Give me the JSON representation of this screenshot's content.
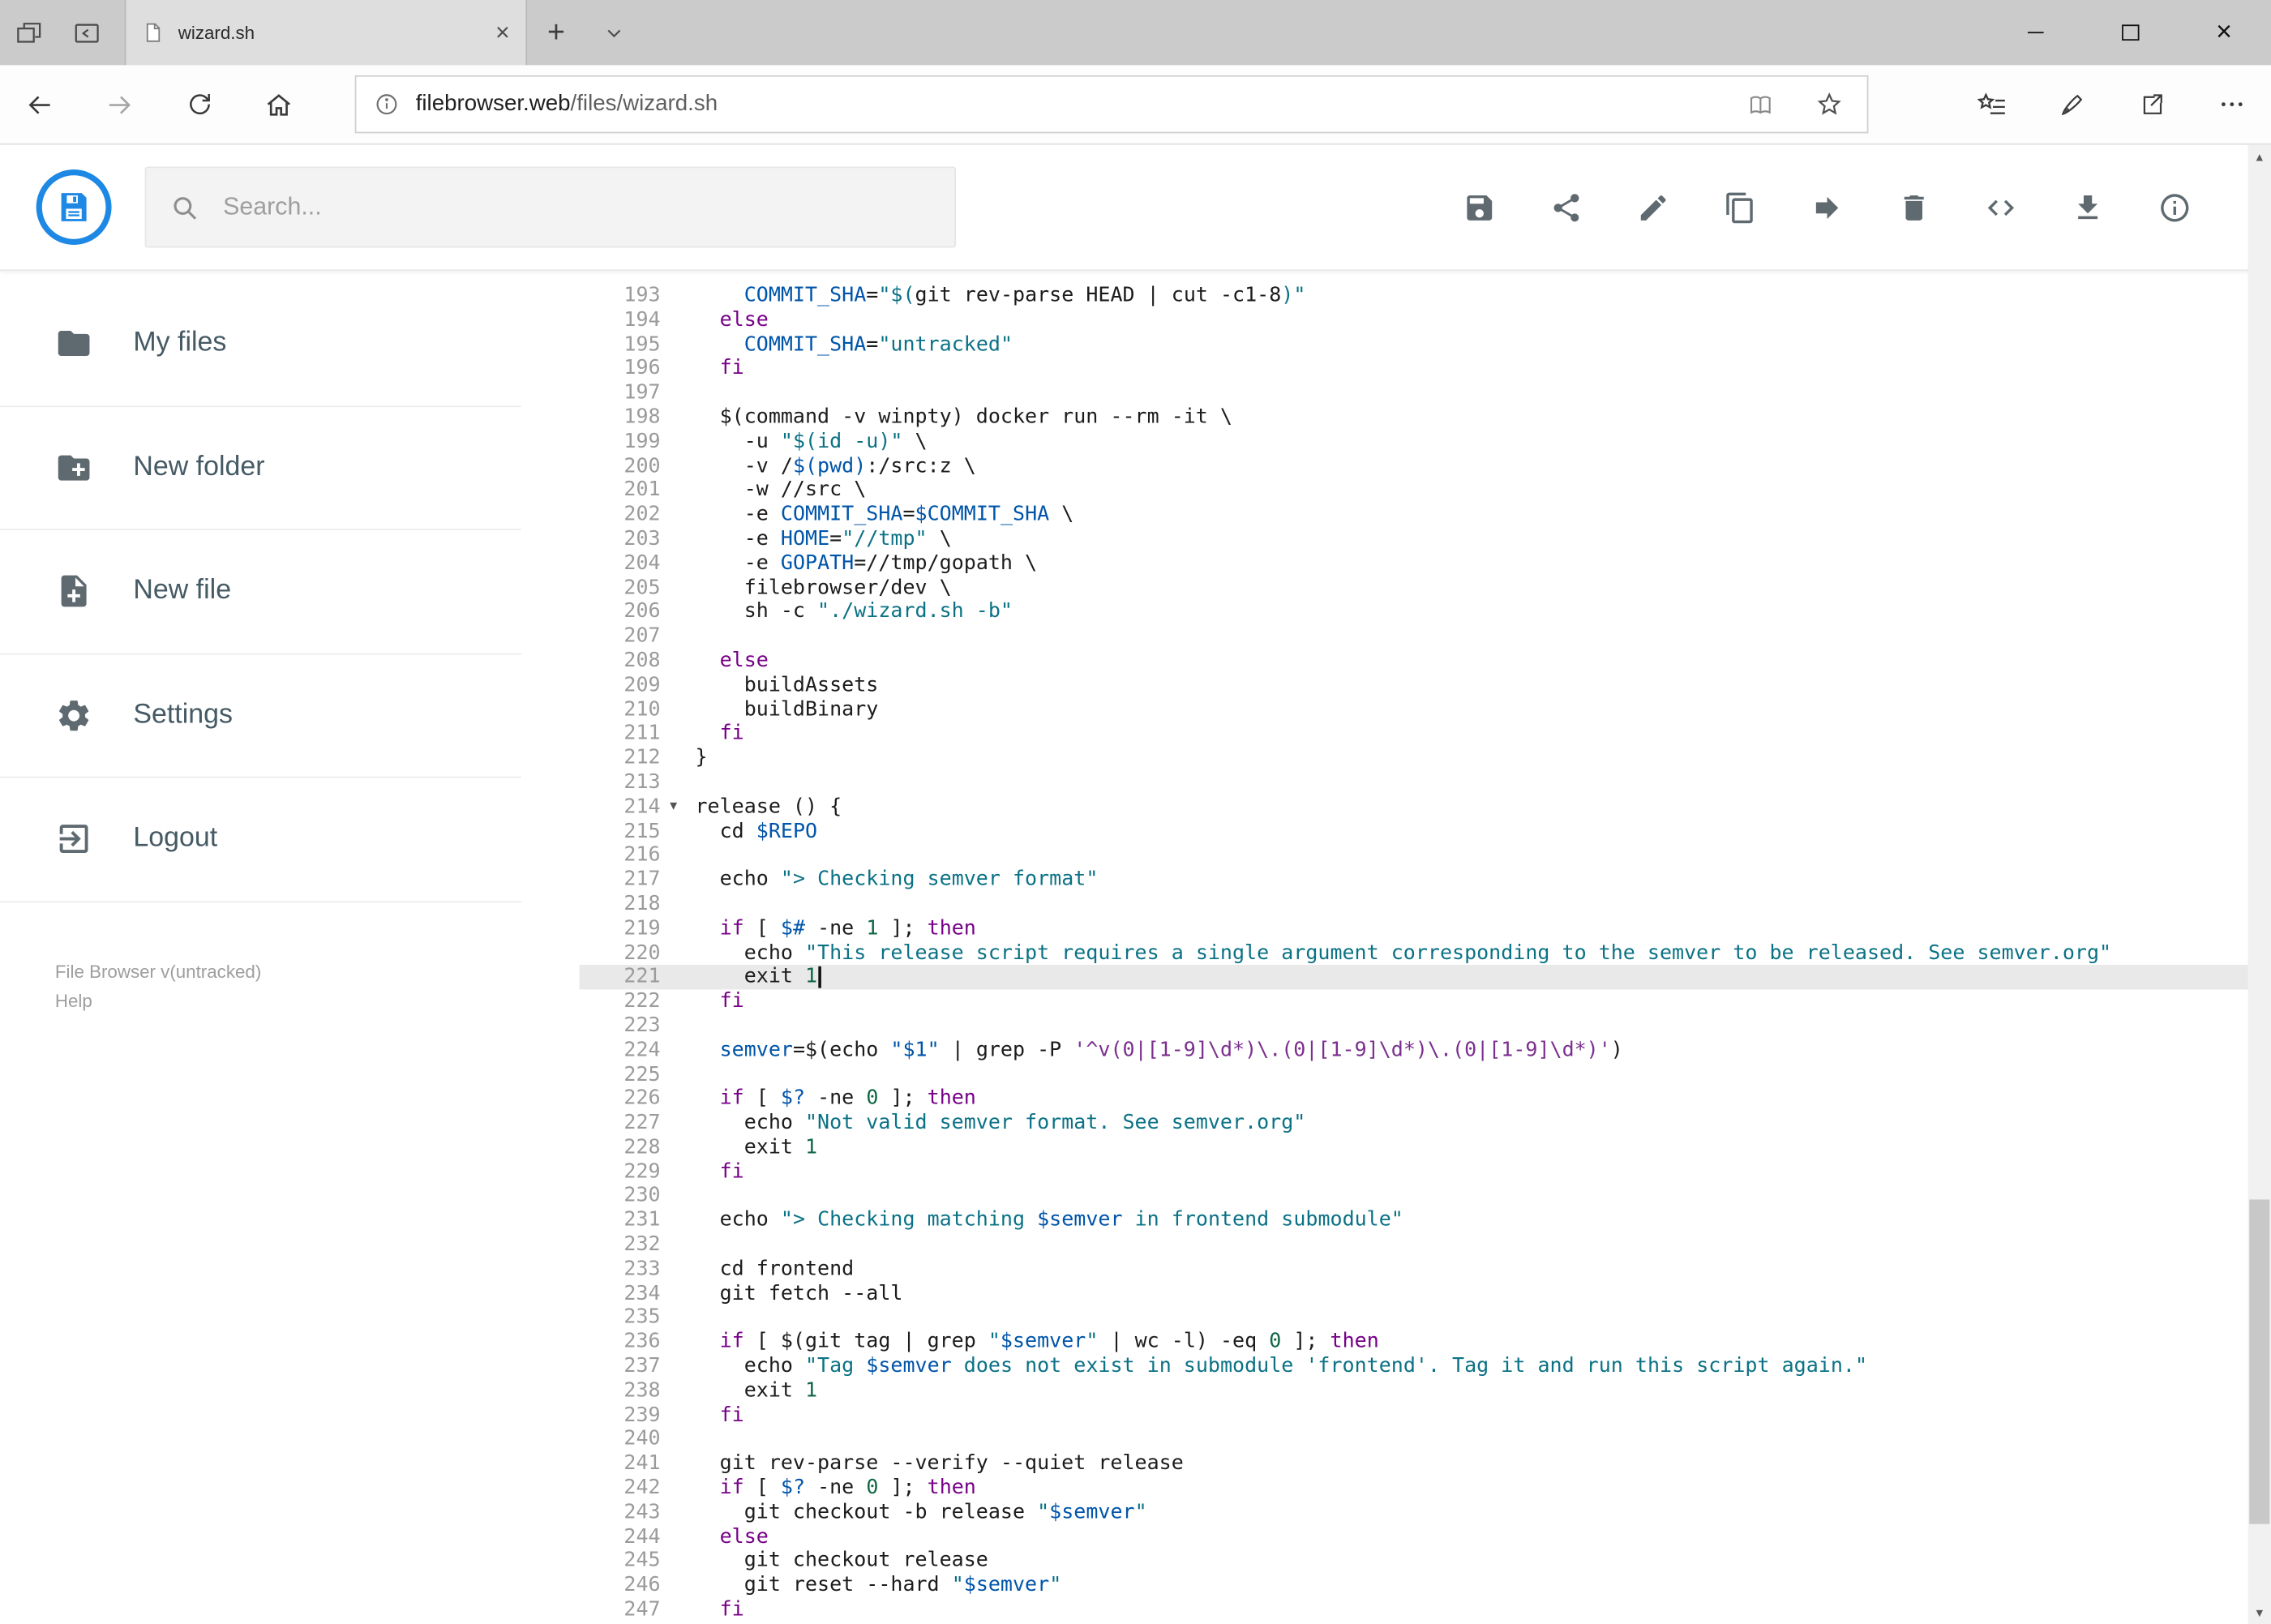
{
  "browser": {
    "tab_title": "wizard.sh",
    "strip_icons": [
      "tab-preview",
      "set-tabs-aside",
      "new-tab",
      "tab-list-chevron"
    ],
    "window_controls": [
      "minimize",
      "maximize",
      "close"
    ],
    "nav_icons": [
      "back",
      "forward",
      "refresh",
      "home"
    ],
    "addressbar": {
      "url_domain": "filebrowser.web",
      "url_path": "/files/wizard.sh",
      "icons": [
        "info",
        "reading-view",
        "favorite-star"
      ]
    },
    "nav_right_icons": [
      "hub",
      "web-note-pen",
      "share",
      "more"
    ]
  },
  "app": {
    "search": {
      "placeholder": "Search..."
    },
    "toolbar_icons": [
      "save",
      "share",
      "edit",
      "copy",
      "move",
      "delete",
      "code",
      "download",
      "info"
    ],
    "sidebar": {
      "items": [
        {
          "label": "My files",
          "icon": "folder"
        },
        {
          "label": "New folder",
          "icon": "create-new-folder"
        },
        {
          "label": "New file",
          "icon": "new-file"
        },
        {
          "label": "Settings",
          "icon": "settings"
        },
        {
          "label": "Logout",
          "icon": "logout"
        }
      ],
      "footer_version": "File Browser v(untracked)",
      "footer_help": "Help"
    },
    "editor": {
      "first_visible_line": 193,
      "last_visible_line": 247,
      "active_line": 221,
      "fold_marker_line": 214,
      "lines": [
        {
          "n": 193,
          "t": [
            [
              "p",
              "    "
            ],
            [
              "v",
              "COMMIT_SHA"
            ],
            [
              "p",
              "="
            ],
            [
              "s",
              "\"$("
            ],
            [
              "p",
              "git rev-parse HEAD | cut -c1-8"
            ],
            [
              "s",
              ")\""
            ]
          ]
        },
        {
          "n": 194,
          "t": [
            [
              "p",
              "  "
            ],
            [
              "k",
              "else"
            ]
          ]
        },
        {
          "n": 195,
          "t": [
            [
              "p",
              "    "
            ],
            [
              "v",
              "COMMIT_SHA"
            ],
            [
              "p",
              "="
            ],
            [
              "s",
              "\"untracked\""
            ]
          ]
        },
        {
          "n": 196,
          "t": [
            [
              "p",
              "  "
            ],
            [
              "k",
              "fi"
            ]
          ]
        },
        {
          "n": 197,
          "t": []
        },
        {
          "n": 198,
          "t": [
            [
              "p",
              "  $(command -v winpty) docker run --rm -it \\"
            ]
          ]
        },
        {
          "n": 199,
          "t": [
            [
              "p",
              "    -u "
            ],
            [
              "s",
              "\"$(id -u)\""
            ],
            [
              "p",
              " \\"
            ]
          ]
        },
        {
          "n": 200,
          "t": [
            [
              "p",
              "    -v /"
            ],
            [
              "v",
              "$(pwd)"
            ],
            [
              "p",
              ":/src:z \\"
            ]
          ]
        },
        {
          "n": 201,
          "t": [
            [
              "p",
              "    -w //src \\"
            ]
          ]
        },
        {
          "n": 202,
          "t": [
            [
              "p",
              "    -e "
            ],
            [
              "v",
              "COMMIT_SHA"
            ],
            [
              "p",
              "="
            ],
            [
              "v",
              "$COMMIT_SHA"
            ],
            [
              "p",
              " \\"
            ]
          ]
        },
        {
          "n": 203,
          "t": [
            [
              "p",
              "    -e "
            ],
            [
              "v",
              "HOME"
            ],
            [
              "p",
              "="
            ],
            [
              "s",
              "\"//tmp\""
            ],
            [
              "p",
              " \\"
            ]
          ]
        },
        {
          "n": 204,
          "t": [
            [
              "p",
              "    -e "
            ],
            [
              "v",
              "GOPATH"
            ],
            [
              "p",
              "=//tmp/gopath \\"
            ]
          ]
        },
        {
          "n": 205,
          "t": [
            [
              "p",
              "    filebrowser/dev \\"
            ]
          ]
        },
        {
          "n": 206,
          "t": [
            [
              "p",
              "    sh -c "
            ],
            [
              "s",
              "\"./wizard.sh -b\""
            ]
          ]
        },
        {
          "n": 207,
          "t": []
        },
        {
          "n": 208,
          "t": [
            [
              "p",
              "  "
            ],
            [
              "k",
              "else"
            ]
          ]
        },
        {
          "n": 209,
          "t": [
            [
              "p",
              "    buildAssets"
            ]
          ]
        },
        {
          "n": 210,
          "t": [
            [
              "p",
              "    buildBinary"
            ]
          ]
        },
        {
          "n": 211,
          "t": [
            [
              "p",
              "  "
            ],
            [
              "k",
              "fi"
            ]
          ]
        },
        {
          "n": 212,
          "t": [
            [
              "p",
              "}"
            ]
          ]
        },
        {
          "n": 213,
          "t": []
        },
        {
          "n": 214,
          "t": [
            [
              "p",
              "release () {"
            ]
          ]
        },
        {
          "n": 215,
          "t": [
            [
              "p",
              "  cd "
            ],
            [
              "v",
              "$REPO"
            ]
          ]
        },
        {
          "n": 216,
          "t": []
        },
        {
          "n": 217,
          "t": [
            [
              "p",
              "  echo "
            ],
            [
              "s",
              "\"> Checking semver format\""
            ]
          ]
        },
        {
          "n": 218,
          "t": []
        },
        {
          "n": 219,
          "t": [
            [
              "p",
              "  "
            ],
            [
              "k",
              "if"
            ],
            [
              "p",
              " [ "
            ],
            [
              "v",
              "$#"
            ],
            [
              "p",
              " -ne "
            ],
            [
              "n",
              "1"
            ],
            [
              "p",
              " ]; "
            ],
            [
              "k",
              "then"
            ]
          ]
        },
        {
          "n": 220,
          "t": [
            [
              "p",
              "    echo "
            ],
            [
              "s",
              "\"This release script requires a single argument corresponding to the semver to be released. See semver.org\""
            ]
          ]
        },
        {
          "n": 221,
          "t": [
            [
              "p",
              "    exit "
            ],
            [
              "n",
              "1"
            ]
          ]
        },
        {
          "n": 222,
          "t": [
            [
              "p",
              "  "
            ],
            [
              "k",
              "fi"
            ]
          ]
        },
        {
          "n": 223,
          "t": []
        },
        {
          "n": 224,
          "t": [
            [
              "p",
              "  "
            ],
            [
              "v",
              "semver"
            ],
            [
              "p",
              "=$(echo "
            ],
            [
              "v",
              "\"$1\""
            ],
            [
              "p",
              " | grep -P "
            ],
            [
              "r",
              "'^v(0|[1-9]\\d*)\\.(0|[1-9]\\d*)\\.(0|[1-9]\\d*)'"
            ],
            [
              "p",
              ")"
            ]
          ]
        },
        {
          "n": 225,
          "t": []
        },
        {
          "n": 226,
          "t": [
            [
              "p",
              "  "
            ],
            [
              "k",
              "if"
            ],
            [
              "p",
              " [ "
            ],
            [
              "v",
              "$?"
            ],
            [
              "p",
              " -ne "
            ],
            [
              "n",
              "0"
            ],
            [
              "p",
              " ]; "
            ],
            [
              "k",
              "then"
            ]
          ]
        },
        {
          "n": 227,
          "t": [
            [
              "p",
              "    echo "
            ],
            [
              "s",
              "\"Not valid semver format. See semver.org\""
            ]
          ]
        },
        {
          "n": 228,
          "t": [
            [
              "p",
              "    exit "
            ],
            [
              "n",
              "1"
            ]
          ]
        },
        {
          "n": 229,
          "t": [
            [
              "p",
              "  "
            ],
            [
              "k",
              "fi"
            ]
          ]
        },
        {
          "n": 230,
          "t": []
        },
        {
          "n": 231,
          "t": [
            [
              "p",
              "  echo "
            ],
            [
              "s",
              "\"> Checking matching "
            ],
            [
              "v",
              "$semver"
            ],
            [
              "s",
              " in frontend submodule\""
            ]
          ]
        },
        {
          "n": 232,
          "t": []
        },
        {
          "n": 233,
          "t": [
            [
              "p",
              "  cd frontend"
            ]
          ]
        },
        {
          "n": 234,
          "t": [
            [
              "p",
              "  git fetch --all"
            ]
          ]
        },
        {
          "n": 235,
          "t": []
        },
        {
          "n": 236,
          "t": [
            [
              "p",
              "  "
            ],
            [
              "k",
              "if"
            ],
            [
              "p",
              " [ $(git tag | grep "
            ],
            [
              "s",
              "\""
            ],
            [
              "v",
              "$semver"
            ],
            [
              "s",
              "\""
            ],
            [
              "p",
              " | wc -l) -eq "
            ],
            [
              "n",
              "0"
            ],
            [
              "p",
              " ]; "
            ],
            [
              "k",
              "then"
            ]
          ]
        },
        {
          "n": 237,
          "t": [
            [
              "p",
              "    echo "
            ],
            [
              "s",
              "\"Tag "
            ],
            [
              "v",
              "$semver"
            ],
            [
              "s",
              " does not exist in submodule 'frontend'. Tag it and run this script again.\""
            ]
          ]
        },
        {
          "n": 238,
          "t": [
            [
              "p",
              "    exit "
            ],
            [
              "n",
              "1"
            ]
          ]
        },
        {
          "n": 239,
          "t": [
            [
              "p",
              "  "
            ],
            [
              "k",
              "fi"
            ]
          ]
        },
        {
          "n": 240,
          "t": []
        },
        {
          "n": 241,
          "t": [
            [
              "p",
              "  git rev-parse --verify --quiet release"
            ]
          ]
        },
        {
          "n": 242,
          "t": [
            [
              "p",
              "  "
            ],
            [
              "k",
              "if"
            ],
            [
              "p",
              " [ "
            ],
            [
              "v",
              "$?"
            ],
            [
              "p",
              " -ne "
            ],
            [
              "n",
              "0"
            ],
            [
              "p",
              " ]; "
            ],
            [
              "k",
              "then"
            ]
          ]
        },
        {
          "n": 243,
          "t": [
            [
              "p",
              "    git checkout -b release "
            ],
            [
              "s",
              "\""
            ],
            [
              "v",
              "$semver"
            ],
            [
              "s",
              "\""
            ]
          ]
        },
        {
          "n": 244,
          "t": [
            [
              "p",
              "  "
            ],
            [
              "k",
              "else"
            ]
          ]
        },
        {
          "n": 245,
          "t": [
            [
              "p",
              "    git checkout release"
            ]
          ]
        },
        {
          "n": 246,
          "t": [
            [
              "p",
              "    git reset --hard "
            ],
            [
              "s",
              "\""
            ],
            [
              "v",
              "$semver"
            ],
            [
              "s",
              "\""
            ]
          ]
        },
        {
          "n": 247,
          "t": [
            [
              "p",
              "  "
            ],
            [
              "k",
              "fi"
            ]
          ]
        }
      ]
    }
  },
  "colors": {
    "accent_blue": "#1e88e5",
    "code_plain": "#1c1c1c",
    "code_keyword": "#770088",
    "code_string": "#0b7285",
    "code_string2": "#7b2f8e",
    "code_variable": "#0055aa",
    "code_number": "#116644",
    "line_number": "#9b9b9b",
    "active_line_bg": "#e9e9e9"
  }
}
